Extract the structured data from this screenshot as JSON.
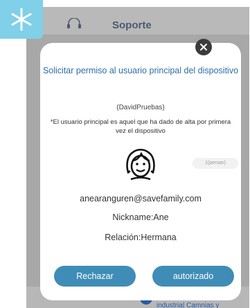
{
  "background": {
    "back_icon": "headset-icon",
    "title": "Soporte",
    "footer_text": "industria| Camnias y"
  },
  "dialog": {
    "title": "Solicitar permiso al usuario principal del dispositivo",
    "device_name": "(DavidPruebas)",
    "note": "*El usuario principal es aquel que ha dado de alta por primera vez el dispositivo",
    "avatar_icon": "user-avatar-icon",
    "pill_text": "1(persan)",
    "email": "anearanguren@savefamily.com",
    "nickname": "Nickname:Ane",
    "relation": "Relación:Hermana",
    "reject_label": "Rechazar",
    "accept_label": "autorizado"
  },
  "colors": {
    "accent": "#3f8db6",
    "title_blue": "#2c6fa8",
    "badge": "#7fd0e8",
    "overlay": "#a8a8a8"
  }
}
